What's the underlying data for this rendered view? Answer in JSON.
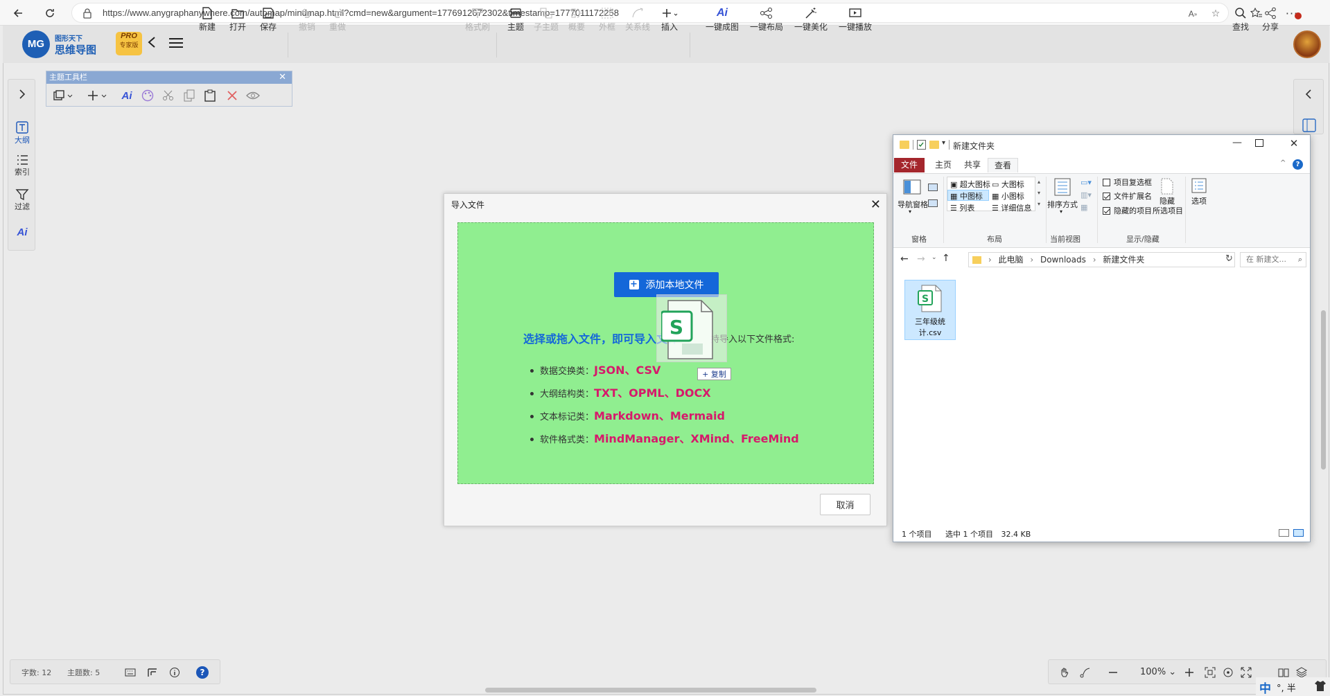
{
  "browser": {
    "url": "https://www.anygraphanywhere.com/automap/mindmap.html?cmd=new&argument=1776912672302&timestamp=1777011172258"
  },
  "app": {
    "logo": {
      "cn_small": "图形天下",
      "cn_big": "思维导图",
      "pro": "PRO",
      "edition": "专家版",
      "mark": "MG"
    },
    "toolbar": [
      {
        "key": "new",
        "label": "新建"
      },
      {
        "key": "open",
        "label": "打开"
      },
      {
        "key": "save",
        "label": "保存"
      },
      {
        "key": "undo",
        "label": "撤销"
      },
      {
        "key": "redo",
        "label": "重做"
      },
      {
        "key": "format_brush",
        "label": "格式刷"
      },
      {
        "key": "topic",
        "label": "主题"
      },
      {
        "key": "subtopic",
        "label": "子主题"
      },
      {
        "key": "summary",
        "label": "概要"
      },
      {
        "key": "boundary",
        "label": "外框"
      },
      {
        "key": "relation",
        "label": "关系线"
      },
      {
        "key": "insert",
        "label": "插入"
      },
      {
        "key": "ai_map",
        "label": "一键成图"
      },
      {
        "key": "auto_layout",
        "label": "一键布局"
      },
      {
        "key": "auto_beautify",
        "label": "一键美化"
      },
      {
        "key": "auto_play",
        "label": "一键播放"
      },
      {
        "key": "find",
        "label": "查找"
      },
      {
        "key": "share",
        "label": "分享"
      }
    ],
    "left_sidebar": {
      "outline": "大纲",
      "index": "索引",
      "filter": "过滤"
    },
    "topic_toolbar": {
      "title": "主题工具栏"
    },
    "ai_glyph": "Ai"
  },
  "dialog": {
    "title": "导入文件",
    "add_button": "添加本地文件",
    "hint_main": "选择或拖入文件，即可导入文件",
    "hint_rest": "持导入以下文件格式:",
    "formats": [
      {
        "label": "数据交换类：",
        "types": "JSON、CSV"
      },
      {
        "label": "大纲结构类：",
        "types": "TXT、OPML、DOCX"
      },
      {
        "label": "文本标记类：",
        "types": "Markdown、Mermaid"
      },
      {
        "label": "软件格式类：",
        "types": "MindManager、XMind、FreeMind"
      }
    ],
    "cancel": "取消",
    "drag_copy_tag": "+ 复制"
  },
  "status": {
    "char_count": "字数: 12",
    "topic_count": "主题数: 5",
    "zoom": "100%"
  },
  "explorer": {
    "title": "新建文件夹",
    "tabs": [
      "文件",
      "主页",
      "共享",
      "查看"
    ],
    "ribbon": {
      "nav_pane": "导航窗格",
      "layouts": [
        "超大图标",
        "大图标",
        "中图标",
        "小图标",
        "列表",
        "详细信息"
      ],
      "sort": "排序方式",
      "checkboxes": [
        {
          "label": "项目复选框",
          "checked": false
        },
        {
          "label": "文件扩展名",
          "checked": true
        },
        {
          "label": "隐藏的项目",
          "checked": true
        }
      ],
      "hide_selected_1": "隐藏",
      "hide_selected_2": "所选项目",
      "options": "选项",
      "groups": [
        "窗格",
        "布局",
        "当前视图",
        "显示/隐藏"
      ]
    },
    "path": [
      "此电脑",
      "Downloads",
      "新建文件夹"
    ],
    "search_placeholder": "在 新建文...",
    "file": {
      "name_line1": "三年级统",
      "name_line2": "计.csv",
      "badge": "S"
    },
    "status": {
      "count": "1 个项目",
      "selected": "选中 1 个项目",
      "size": "32.4 KB"
    }
  },
  "tray": {
    "ime": "中",
    "mode": "°, 半"
  }
}
